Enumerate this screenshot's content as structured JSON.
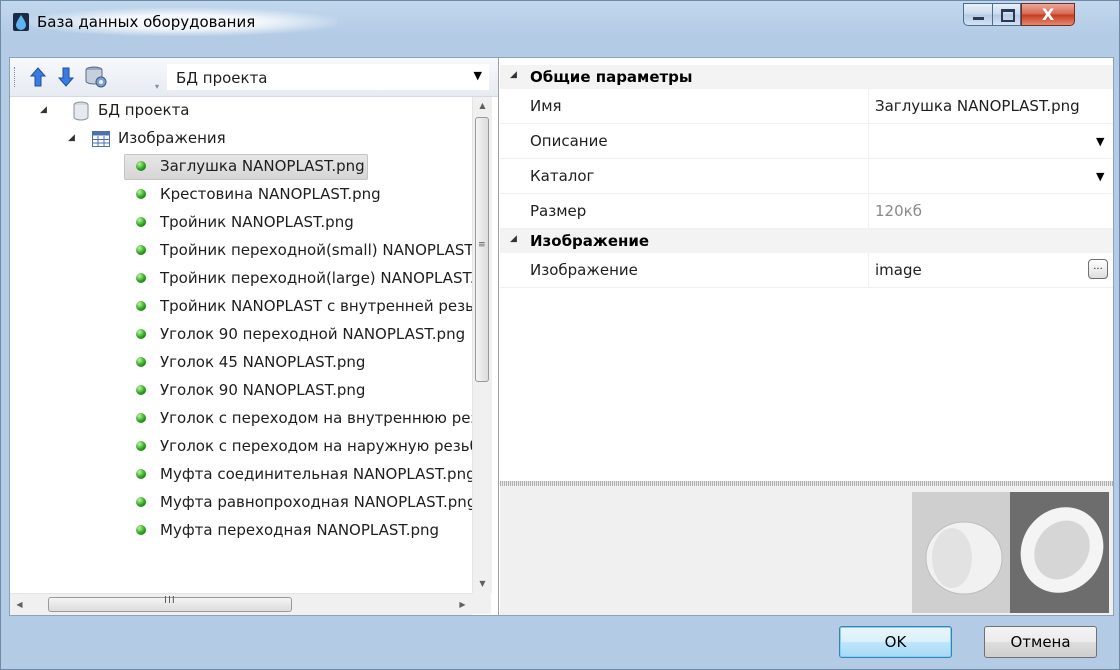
{
  "window": {
    "title": "База данных оборудования"
  },
  "toolbar": {
    "db_select_value": "БД проекта",
    "icons": [
      "arrow-up-icon",
      "arrow-down-icon",
      "database-settings-icon"
    ]
  },
  "tree": {
    "root": "БД проекта",
    "table": "Изображения",
    "items": [
      "Заглушка NANOPLAST.png",
      "Крестовина NANOPLAST.png",
      "Тройник NANOPLAST.png",
      "Тройник переходной(small) NANOPLAST.png",
      "Тройник переходной(large) NANOPLAST.png",
      "Тройник NANOPLAST с внутренней резьбой.png",
      "Уголок 90 переходной NANOPLAST.png",
      "Уголок 45 NANOPLAST.png",
      "Уголок 90 NANOPLAST.png",
      "Уголок с переходом на внутреннюю резьбу.png",
      "Уголок с переходом на наружную резьбу.png",
      "Муфта соединительная NANOPLAST.png",
      "Муфта равнопроходная NANOPLAST.png",
      "Муфта переходная NANOPLAST.png"
    ],
    "selected_index": 0
  },
  "properties": {
    "general_category": "Общие параметры",
    "name_label": "Имя",
    "name_value": "Заглушка NANOPLAST.png",
    "description_label": "Описание",
    "description_value": "",
    "catalog_label": "Каталог",
    "catalog_value": "",
    "size_label": "Размер",
    "size_value": "120кб",
    "image_category": "Изображение",
    "image_label": "Изображение",
    "image_value": "image",
    "ellipsis": "..."
  },
  "buttons": {
    "ok": "OK",
    "cancel": "Отмена"
  },
  "scroll": {
    "h_grip": "III"
  }
}
